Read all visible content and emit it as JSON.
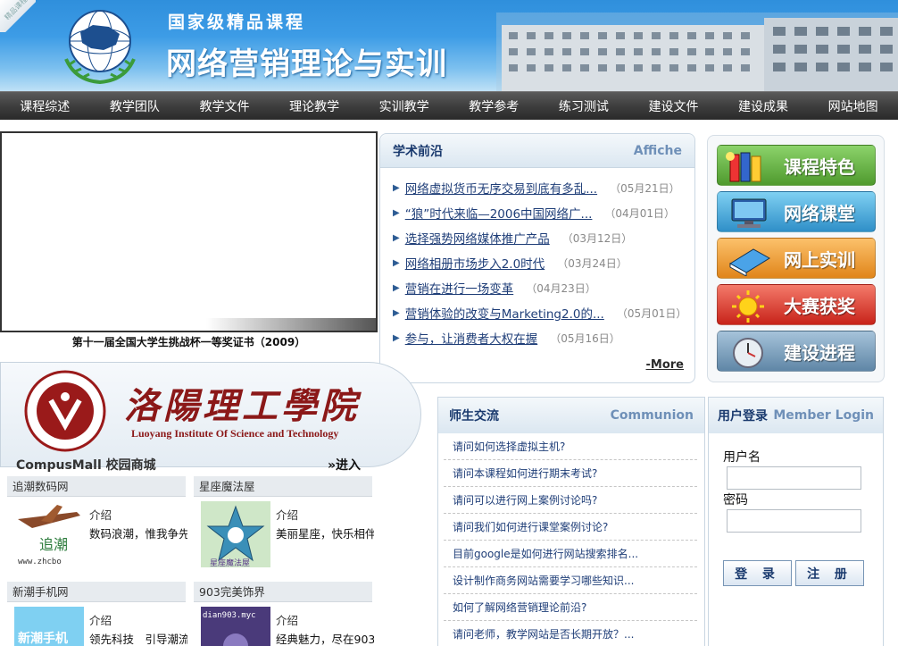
{
  "header": {
    "corner_badge": "精品课程",
    "subtitle": "国家级精品课程",
    "title": "网络营销理论与实训"
  },
  "nav": [
    "课程综述",
    "教学团队",
    "教学文件",
    "理论教学",
    "实训教学",
    "教学参考",
    "练习测试",
    "建设文件",
    "建设成果",
    "网站地图"
  ],
  "photo": {
    "caption": "第十一届全国大学生挑战杯一等奖证书（2009）"
  },
  "news": {
    "title_cn": "学术前沿",
    "title_en": "Affiche",
    "items": [
      {
        "text": "网络虚拟货币无序交易到底有多乱...",
        "date": "（05月21日）"
      },
      {
        "text": "“狼”时代来临—2006中国网络广...",
        "date": "（04月01日）"
      },
      {
        "text": "选择强势网络媒体推广产品",
        "date": "（03月12日）"
      },
      {
        "text": "网络相册市场步入2.0时代",
        "date": "（03月24日）"
      },
      {
        "text": "营销在进行一场变革",
        "date": "（04月23日）"
      },
      {
        "text": "营销体验的改变与Marketing2.0的...",
        "date": "（05月01日）"
      },
      {
        "text": "参与，让消费者大权在握",
        "date": "（05月16日）"
      }
    ],
    "more": "-More"
  },
  "features": [
    {
      "label": "课程特色",
      "icon": "books-icon",
      "color": "#5aa33a"
    },
    {
      "label": "网络课堂",
      "icon": "monitor-icon",
      "color": "#3a9fd4"
    },
    {
      "label": "网上实训",
      "icon": "book-icon",
      "color": "#e88a1a"
    },
    {
      "label": "大赛获奖",
      "icon": "sun-icon",
      "color": "#d9342b"
    },
    {
      "label": "建设进程",
      "icon": "clock-icon",
      "color": "#6d93b0"
    }
  ],
  "college": {
    "name_cn": "洛陽理工學院",
    "name_en": "Luoyang Institute Of Science and Technology"
  },
  "mall": {
    "title": "CompusMall 校园商城",
    "enter": "进入",
    "shops": [
      {
        "name": "追潮数码网",
        "intro": "介绍",
        "desc": "数码浪潮，惟我争先",
        "thumb_text": "追潮",
        "thumb_url": "www.zhcbo"
      },
      {
        "name": "星座魔法屋",
        "intro": "介绍",
        "desc": "美丽星座，快乐相伴",
        "thumb_text": "星座魔法屋"
      },
      {
        "name": "新潮手机网",
        "intro": "介绍",
        "desc": "领先科技　引导潮流",
        "thumb_text": "新潮手机"
      },
      {
        "name": "903完美饰界",
        "intro": "介绍",
        "desc": "经典魅力，尽在903",
        "thumb_text": "dian903.myc"
      }
    ]
  },
  "communion": {
    "title_cn": "师生交流",
    "title_en": "Communion",
    "items": [
      "请问如何选择虚拟主机?",
      "请问本课程如何进行期末考试?",
      "请问可以进行网上案例讨论吗?",
      "请问我们如何进行课堂案例讨论?",
      "目前google是如何进行网站搜索排名...",
      "设计制作商务网站需要学习哪些知识...",
      "如何了解网络营销理论前沿?",
      "请问老师，教学网站是否长期开放？..."
    ]
  },
  "login": {
    "title_cn": "用户登录",
    "title_en": "Member Login",
    "username_label": "用户名",
    "password_label": "密码",
    "login_button": "登 录",
    "register_button": "注 册"
  }
}
